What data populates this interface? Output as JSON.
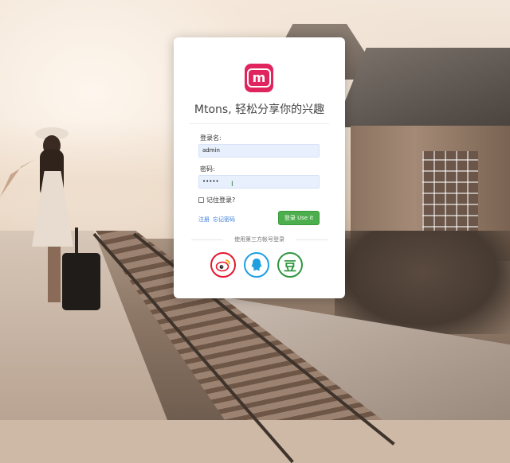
{
  "login": {
    "title": "Mtons, 轻松分享你的兴趣",
    "logo_letter": "m",
    "username_label": "登录名:",
    "username_value": "admin",
    "password_label": "密码:",
    "password_value": "•••••",
    "remember_label": "记住登录?",
    "register_link": "注册",
    "forgot_link": "忘记密码",
    "login_button": "登录 Use it",
    "third_party_label": "使用第三方帐号登录"
  },
  "social": {
    "weibo_icon": "weibo-icon",
    "qq_icon": "qq-icon",
    "douban_glyph": "豆"
  },
  "colors": {
    "brand": "#e0245e",
    "button": "#4cae4c",
    "link": "#3b7dd8",
    "input_bg": "#e8f0fe"
  }
}
